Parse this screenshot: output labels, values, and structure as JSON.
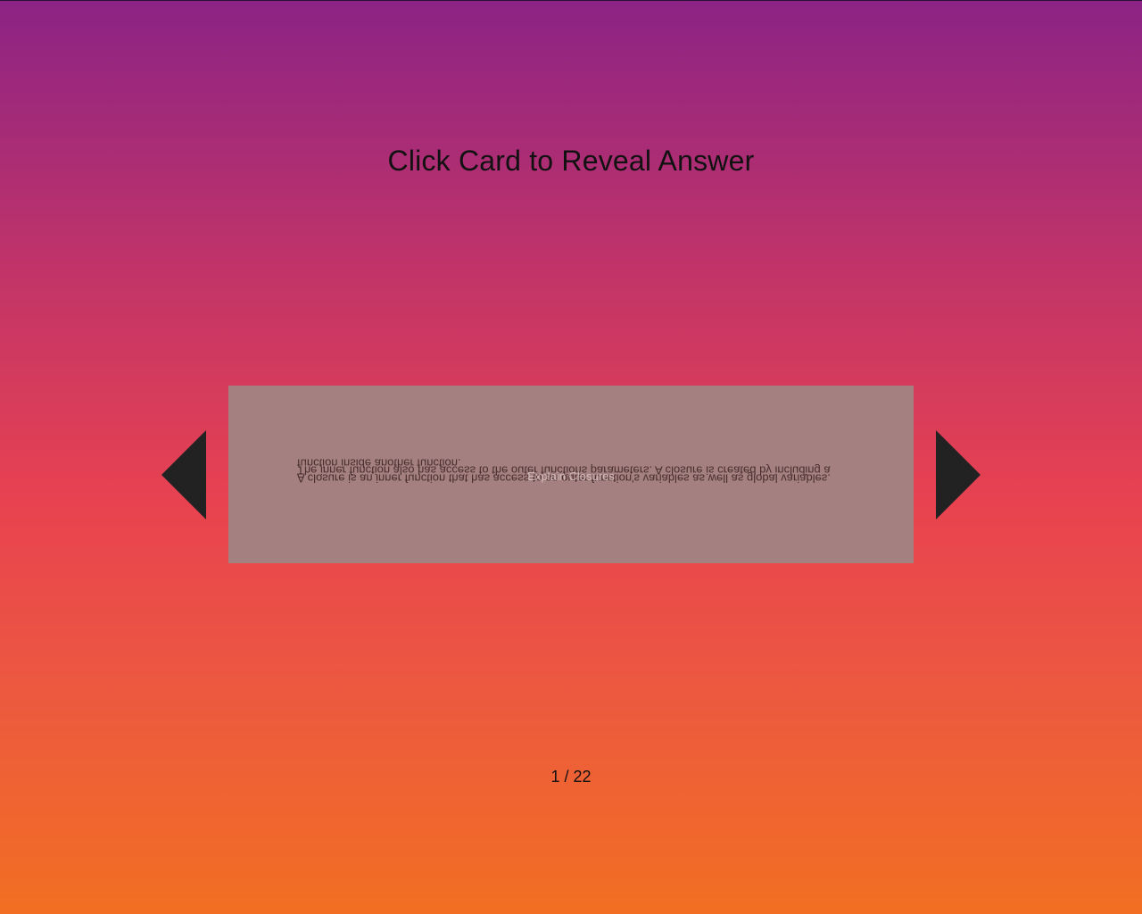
{
  "header": {
    "instruction": "Click Card to Reveal Answer"
  },
  "navigation": {
    "prev_icon": "triangle-left-icon",
    "next_icon": "triangle-right-icon"
  },
  "card": {
    "question": "Explain Closures",
    "answer": "A closure is an inner function that has access to an outer function's variables as well as global variables. The inner function also has access to the outer functions parameters. A closure is created by including a function inside another function."
  },
  "pagination": {
    "counter": "1 / 22"
  },
  "colors": {
    "gradient_top": "#8c2385",
    "gradient_bottom": "#f26f22",
    "card_background": "#a48080",
    "arrow": "#222222"
  }
}
